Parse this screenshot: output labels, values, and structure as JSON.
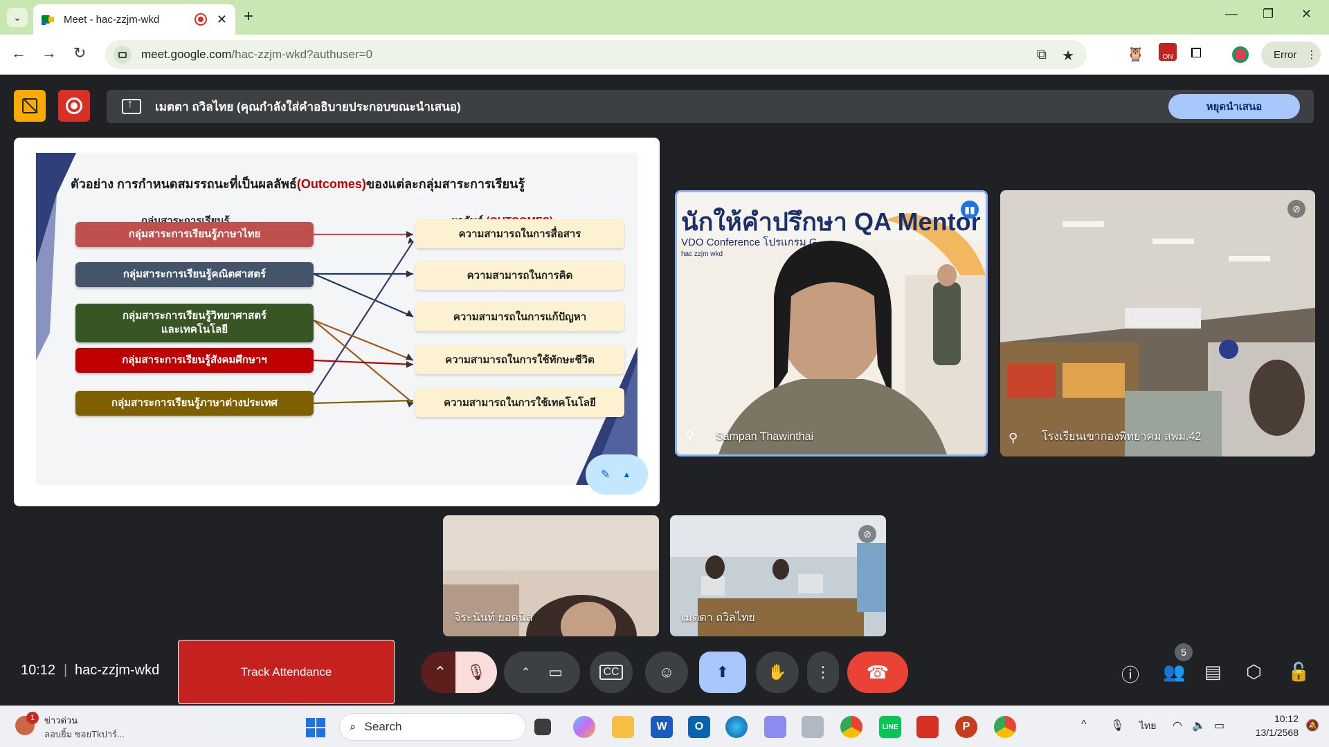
{
  "browser": {
    "tab_title": "Meet - hac-zzjm-wkd",
    "new_tab": "+",
    "url_main": "meet.google.com",
    "url_path": "/hac-zzjm-wkd?authuser=0",
    "error_label": "Error"
  },
  "meet": {
    "presenting_text": "เมตตา ถวิลไทย (คุณกำลังใส่คำอธิบายประกอบขณะนำเสนอ)",
    "stop_presenting": "หยุดนำเสนอ",
    "time": "10:12",
    "meeting_code": "hac-zzjm-wkd",
    "track_attendance": "Track Attendance",
    "participant_count": "5"
  },
  "slide": {
    "title_prefix": "ตัวอย่าง การกำหนดสมรรถนะที่เป็นผลลัพธ์",
    "title_highlight": "(Outcomes)",
    "title_suffix": "ของแต่ละกลุ่มสาระการเรียนรู้",
    "left_header": "กลุ่มสาระการเรียนรู้",
    "right_header_prefix": "ผลลัพธ์ ",
    "right_header_highlight": "(OUTCOMES)",
    "subjects": [
      {
        "label": "กลุ่มสาระการเรียนรู้ภาษาไทย",
        "color": "#c0504d"
      },
      {
        "label": "กลุ่มสาระการเรียนรู้คณิตศาสตร์",
        "color": "#44546a"
      },
      {
        "label": "กลุ่มสาระการเรียนรู้วิทยาศาสตร์\nและเทคโนโลยี",
        "color": "#375623"
      },
      {
        "label": "กลุ่มสาระการเรียนรู้สังคมศึกษาฯ",
        "color": "#c00000"
      },
      {
        "label": "กลุ่มสาระการเรียนรู้ภาษาต่างประเทศ",
        "color": "#7f6000"
      }
    ],
    "outcomes": [
      "ความสามารถในการสื่อสาร",
      "ความสามารถในการคิด",
      "ความสามารถในการแก้ปัญหา",
      "ความสามารถในการใช้ทักษะชีวิต",
      "ความสามารถในการใช้เทคโนโลยี"
    ]
  },
  "participants": [
    {
      "name": "Sampan Thawinthai",
      "backdrop_text": "นักให้คำปรึกษา QA Mentor",
      "backdrop_sub": "VDO Conference โปรแกรม G",
      "backdrop_small": "hac zzjm wkd"
    },
    {
      "name": "โรงเรียนเขากองพิทยาคม สพม.42"
    },
    {
      "name": "จิระนันท์ ยอดนิล"
    },
    {
      "name": "เมตตา ถวิลไทย"
    }
  ],
  "taskbar": {
    "news_title": "ข่าวด่วน",
    "news_sub": "ลอบยิ้ม ซอยTkปาร์...",
    "news_badge": "1",
    "search_placeholder": "Search",
    "lang": "ไทย",
    "time": "10:12",
    "date": "13/1/2568"
  },
  "colors": {
    "meet_bg": "#202124",
    "end_call": "#ea4335",
    "share_active": "#a8c7fa",
    "tabstrip": "#c9e7b3"
  }
}
